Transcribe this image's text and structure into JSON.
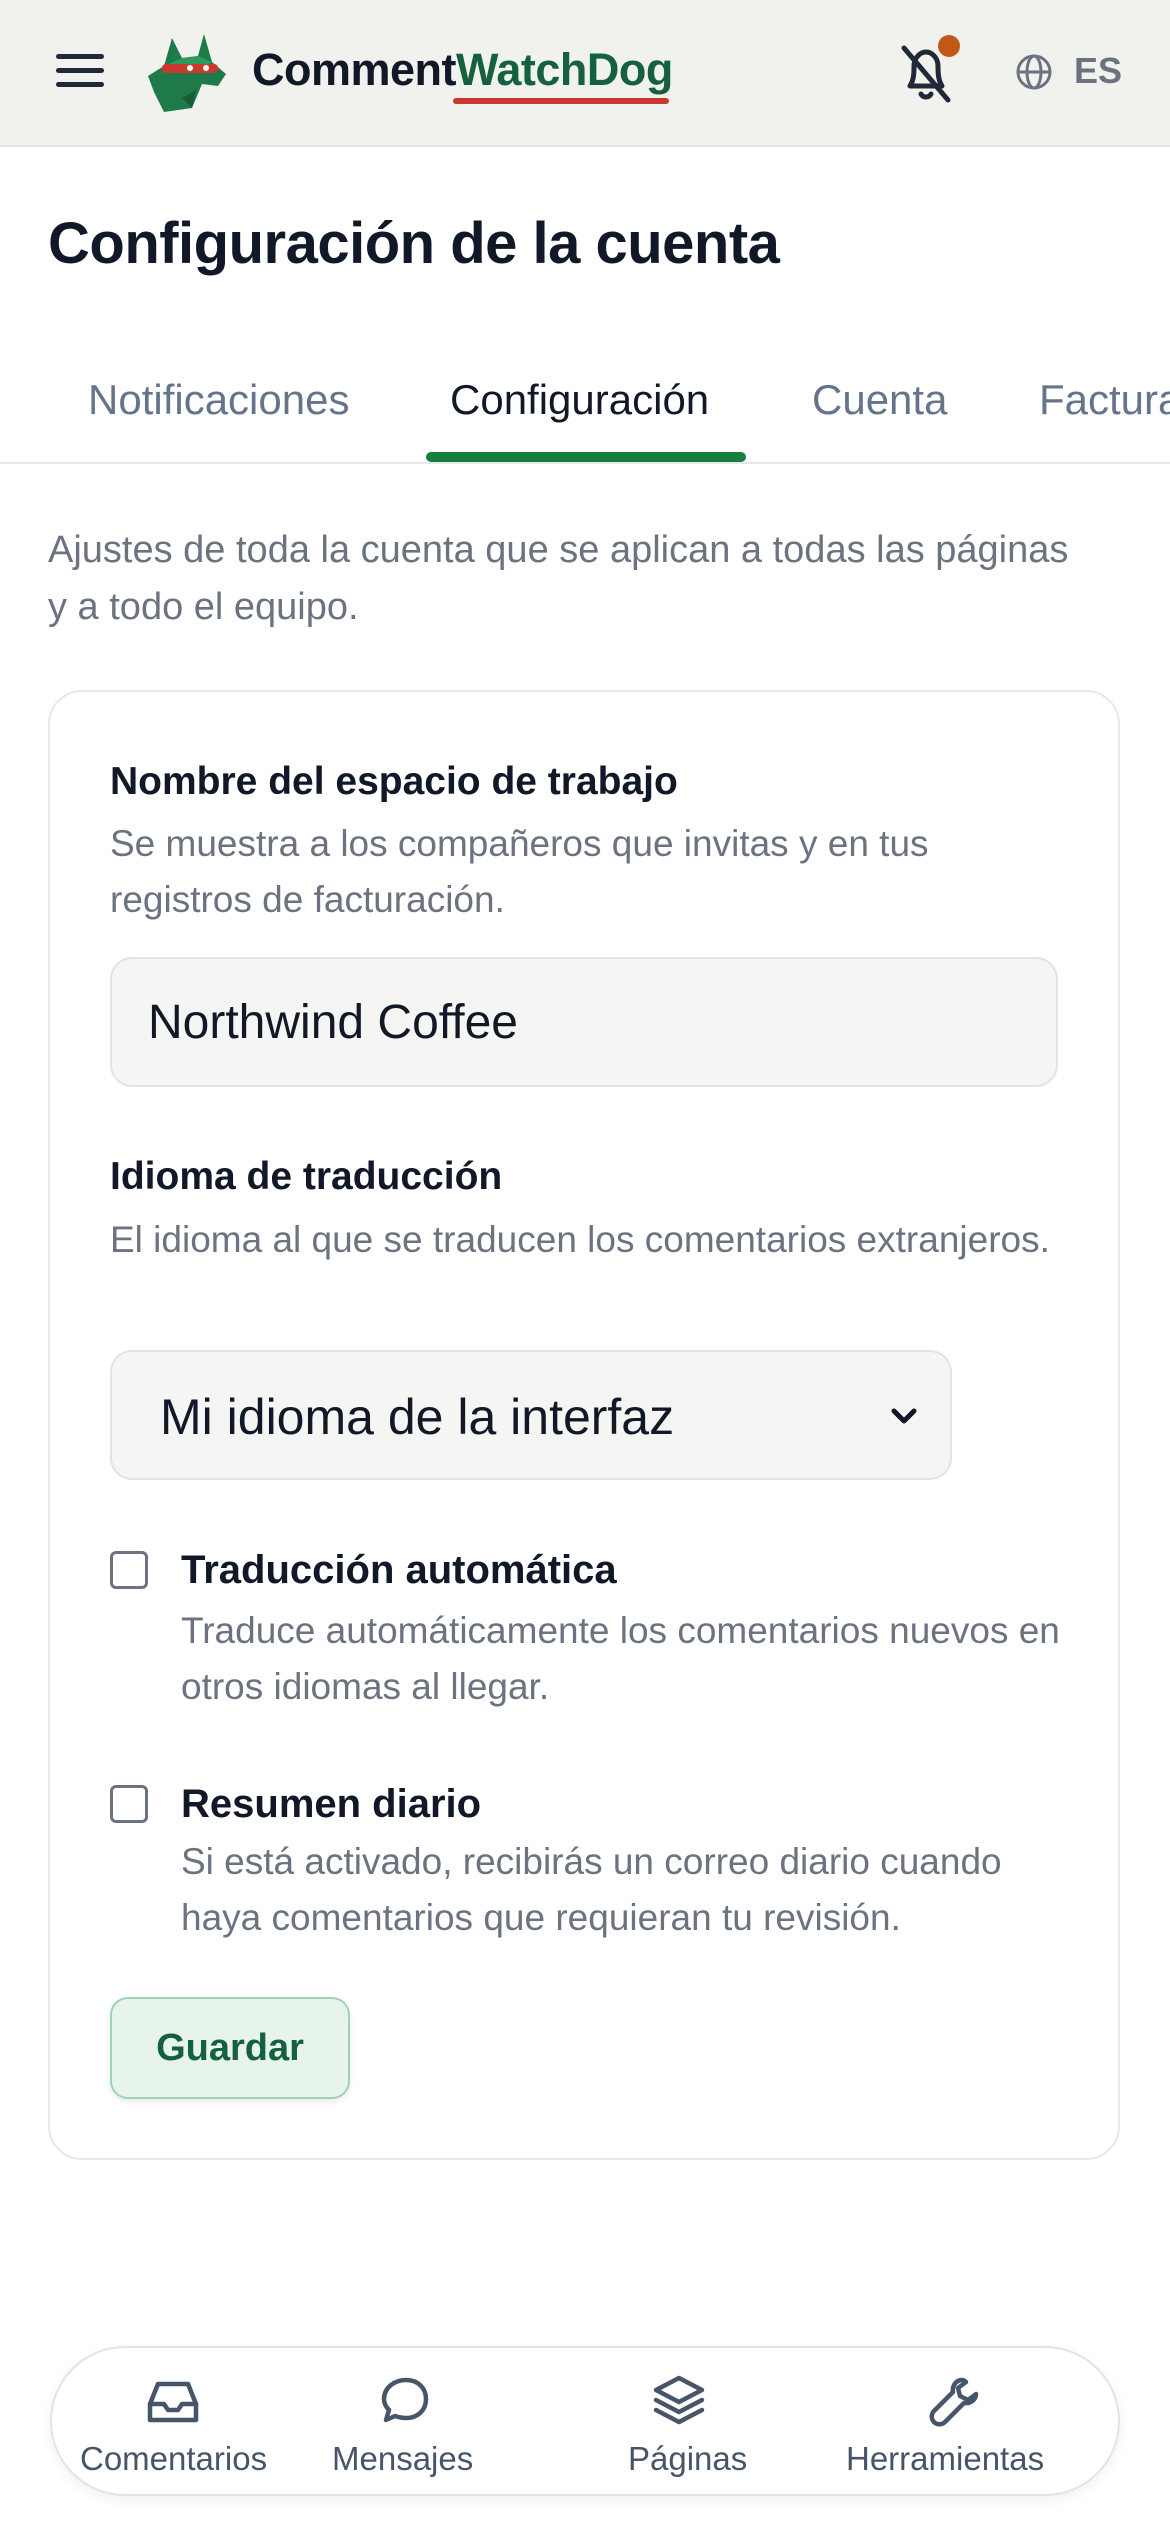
{
  "header": {
    "brand_part1": "Comment",
    "brand_part2": "WatchDog",
    "language": "ES",
    "notification_dot_color": "#c25a17",
    "icons": [
      "menu-icon",
      "logo-icon",
      "bell-off-icon",
      "globe-icon"
    ]
  },
  "page": {
    "title": "Configuración de la cuenta"
  },
  "tabs": [
    {
      "label": "Notificaciones",
      "active": false
    },
    {
      "label": "Configuración",
      "active": true
    },
    {
      "label": "Cuenta",
      "active": false
    },
    {
      "label": "Facturación",
      "active": false
    }
  ],
  "intro": "Ajustes de toda la cuenta que se aplican a todas las páginas y a todo el equipo.",
  "workspace": {
    "label": "Nombre del espacio de trabajo",
    "help": "Se muestra a los compañeros que invitas y en tus registros de facturación.",
    "value": "Northwind Coffee"
  },
  "translation": {
    "label": "Idioma de traducción",
    "help": "El idioma al que se traducen los comentarios extranjeros.",
    "selected": "Mi idioma de la interfaz"
  },
  "auto_translate": {
    "label": "Traducción automática",
    "help": "Traduce automáticamente los comentarios nuevos en otros idiomas al llegar.",
    "checked": false
  },
  "daily_summary": {
    "label": "Resumen diario",
    "help": "Si está activado, recibirás un correo diario cuando haya comentarios que requieran tu revisión.",
    "checked": false
  },
  "save_label": "Guardar",
  "nav": [
    {
      "label": "Comentarios",
      "icon": "inbox-icon"
    },
    {
      "label": "Mensajes",
      "icon": "chat-bubble-icon"
    },
    {
      "label": "Páginas",
      "icon": "layers-icon"
    },
    {
      "label": "Herramientas",
      "icon": "wrench-icon"
    }
  ],
  "colors": {
    "accent": "#15803d",
    "brand_green": "#15613d",
    "brand_underline": "#c9392f"
  }
}
